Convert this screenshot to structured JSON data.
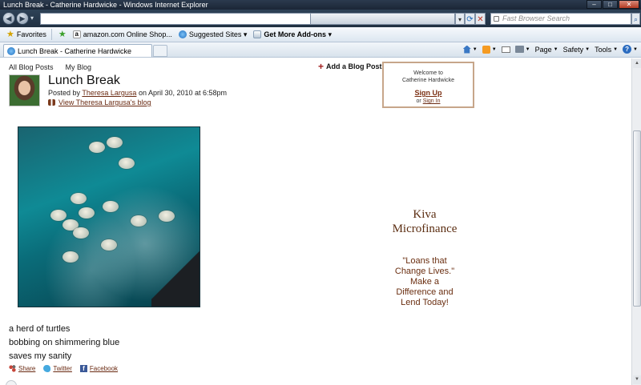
{
  "window": {
    "title": "Lunch Break - Catherine Hardwicke - Windows Internet Explorer",
    "controls": {
      "minimize": "–",
      "maximize": "□",
      "close": "✕"
    }
  },
  "navigation": {
    "back_icon": "back-arrow-icon",
    "forward_icon": "forward-arrow-icon",
    "address_value": "",
    "search_placeholder": "Fast Browser Search"
  },
  "favorites_bar": {
    "favorites_label": "Favorites",
    "items": [
      {
        "label": "amazon.com Online Shop...",
        "icon": "amazon-icon"
      },
      {
        "label": "Suggested Sites ▾",
        "icon": "ie-icon"
      },
      {
        "label": "Get More Add-ons ▾",
        "icon": "addons-icon"
      }
    ]
  },
  "tabs": [
    {
      "label": "Lunch Break - Catherine Hardwicke",
      "active": true
    }
  ],
  "command_bar": {
    "page_label": "Page",
    "safety_label": "Safety",
    "tools_label": "Tools"
  },
  "page": {
    "top_nav": [
      "All Blog Posts",
      "My Blog"
    ],
    "add_post_label": "Add a Blog Post",
    "post": {
      "title": "Lunch Break",
      "posted_by_prefix": "Posted by",
      "author": "Theresa Largusa",
      "date_text": "on April 30, 2010 at 6:58pm",
      "view_blog_label": "View Theresa Largusa's blog"
    },
    "signin_box": {
      "welcome": "Welcome to",
      "site": "Catherine Hardwicke",
      "signup": "Sign Up",
      "or": "or",
      "signin": "Sign In"
    },
    "poem": [
      "a herd of turtles",
      "bobbing on shimmering blue",
      "saves my sanity"
    ],
    "social": [
      {
        "label": "Share",
        "icon": "share-icon"
      },
      {
        "label": "Twitter",
        "icon": "twitter-icon"
      },
      {
        "label": "Facebook",
        "icon": "facebook-icon"
      }
    ],
    "ad": {
      "title_line1": "Kiva",
      "title_line2": "Microfinance",
      "tagline": [
        "\"Loans that",
        "Change Lives.\"",
        "Make a",
        "Difference and",
        "Lend Today!"
      ]
    }
  },
  "colors": {
    "link": "#6a2a12",
    "ad_text": "#5b2d11",
    "signin_border": "#c7a68a",
    "chrome_dark": "#203042"
  }
}
